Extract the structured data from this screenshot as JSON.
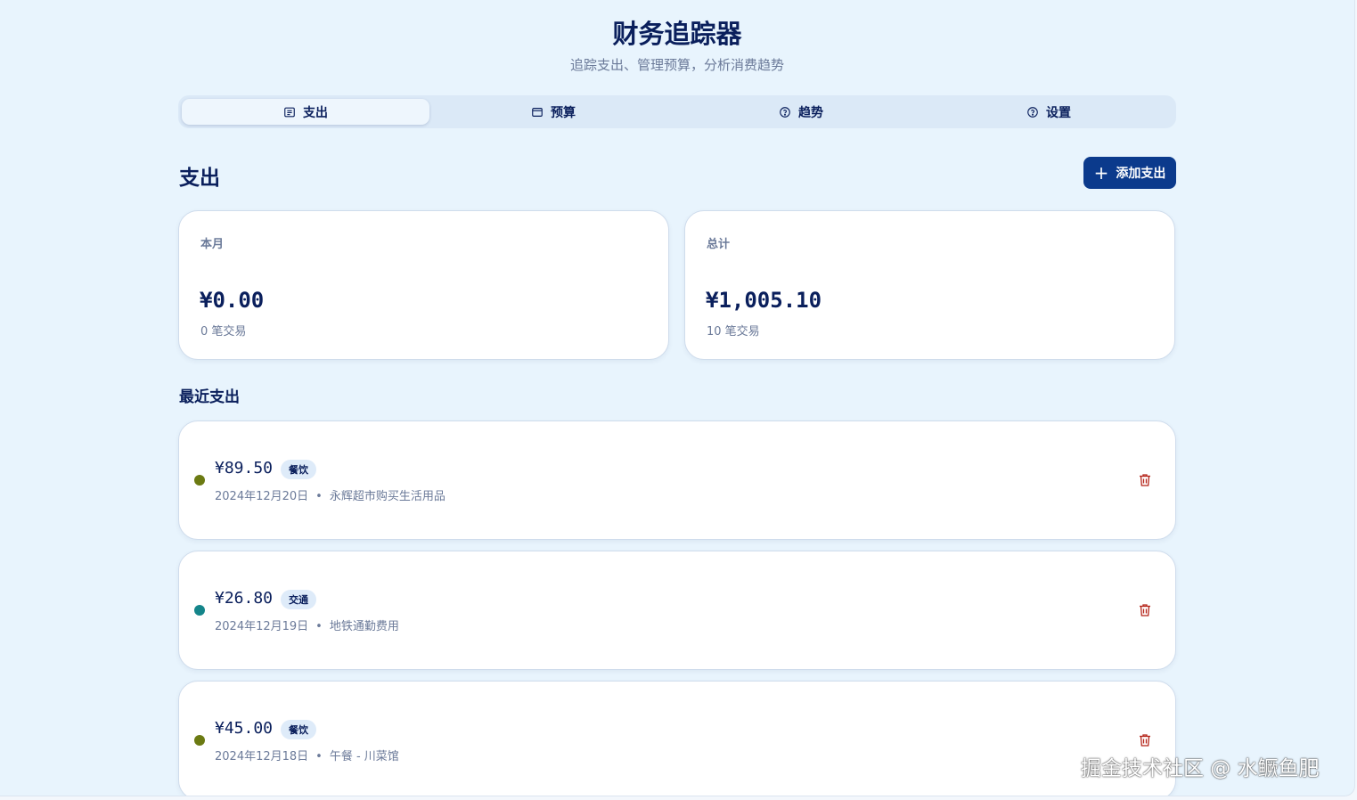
{
  "app": {
    "title": "财务追踪器",
    "subtitle": "追踪支出、管理预算，分析消费趋势"
  },
  "tabs": [
    {
      "label": "支出",
      "icon": "receipt-icon",
      "active": true
    },
    {
      "label": "预算",
      "icon": "wallet-icon",
      "active": false
    },
    {
      "label": "趋势",
      "icon": "help-circle-icon",
      "active": false
    },
    {
      "label": "设置",
      "icon": "help-circle-icon",
      "active": false
    }
  ],
  "page": {
    "section_title": "支出",
    "add_button_label": "添加支出"
  },
  "stats": [
    {
      "label": "本月",
      "value": "¥0.00",
      "sub": "0 笔交易"
    },
    {
      "label": "总计",
      "value": "¥1,005.10",
      "sub": "10 笔交易"
    }
  ],
  "recent": {
    "title": "最近支出",
    "items": [
      {
        "amount": "¥89.50",
        "category": "餐饮",
        "date": "2024年12月20日",
        "description": "永辉超市购买生活用品",
        "dot_color": "#6b7a12"
      },
      {
        "amount": "¥26.80",
        "category": "交通",
        "date": "2024年12月19日",
        "description": "地铁通勤费用",
        "dot_color": "#14858a"
      },
      {
        "amount": "¥45.00",
        "category": "餐饮",
        "date": "2024年12月18日",
        "description": "午餐 - 川菜馆",
        "dot_color": "#6b7a12"
      }
    ],
    "separator": "•"
  },
  "colors": {
    "background": "#e8f4fd",
    "primary": "#0b3a8c",
    "text_dark": "#0a1f5c",
    "text_muted": "#6b7a99",
    "danger": "#b42318"
  },
  "watermark": "掘金技术社区 @ 水鳜鱼肥"
}
